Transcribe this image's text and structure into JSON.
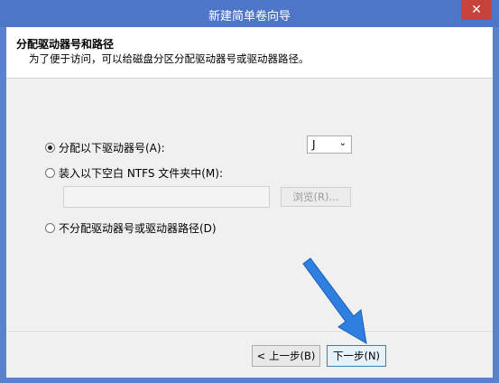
{
  "window": {
    "title": "新建简单卷向导",
    "close_glyph": "✕"
  },
  "header": {
    "title": "分配驱动器号和路径",
    "subtitle": "为了便于访问，可以给磁盘分区分配驱动器号或驱动器路径。"
  },
  "options": {
    "assign_letter": {
      "label": "分配以下驱动器号(A):",
      "selected": true
    },
    "mount_folder": {
      "label": "装入以下空白 NTFS 文件夹中(M):",
      "selected": false
    },
    "no_assign": {
      "label": "不分配驱动器号或驱动器路径(D)",
      "selected": false
    }
  },
  "drive_letter": {
    "value": "J",
    "arrow": "⌄"
  },
  "folder_path": {
    "value": ""
  },
  "browse_button": {
    "label": "浏览(R)..."
  },
  "footer": {
    "back_label": "< 上一步(B)",
    "next_label": "下一步(N)"
  },
  "colors": {
    "titlebar": "#4e76c8",
    "close": "#c7423a",
    "annotation_arrow": "#2f7fe0"
  }
}
